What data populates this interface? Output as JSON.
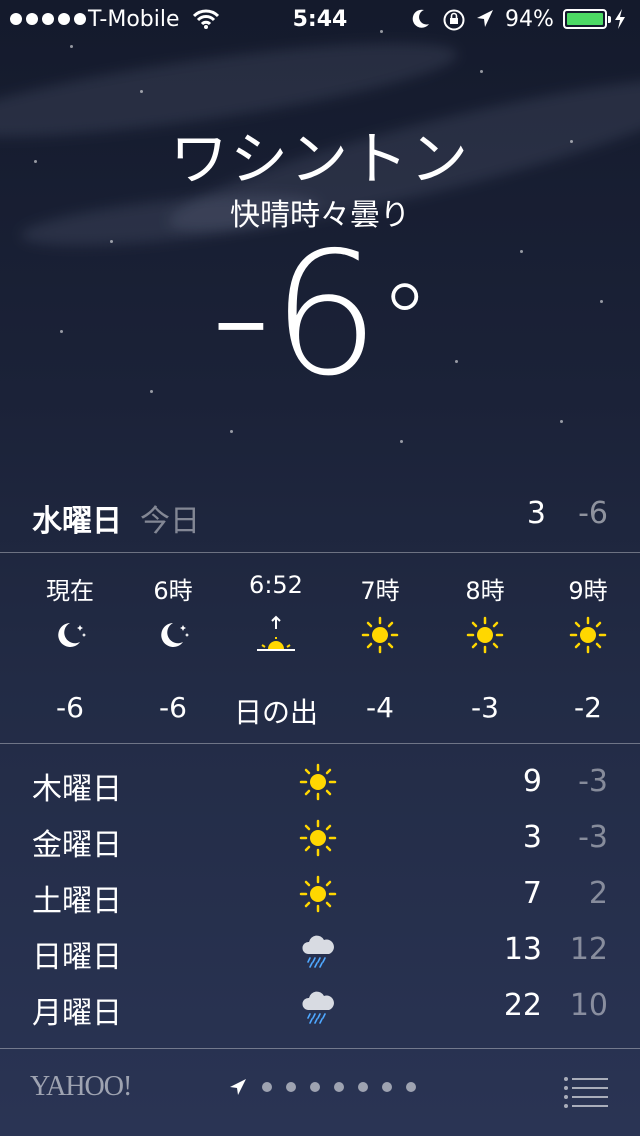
{
  "status_bar": {
    "carrier": "T-Mobile",
    "time": "5:44",
    "battery_percent": "94%",
    "battery_level": 0.94,
    "signal_dots": 5
  },
  "header": {
    "city": "ワシントン",
    "condition": "快晴時々曇り",
    "temperature": "-6",
    "degree_symbol": "°"
  },
  "today": {
    "day": "水曜日",
    "label": "今日",
    "high": "3",
    "low": "-6"
  },
  "hourly": [
    {
      "time": "現在",
      "icon": "moon-stars-icon",
      "value": "-6"
    },
    {
      "time": "6時",
      "icon": "moon-stars-icon",
      "value": "-6"
    },
    {
      "time": "6:52",
      "icon": "sunrise-icon",
      "value": "日の出"
    },
    {
      "time": "7時",
      "icon": "sun-icon",
      "value": "-4"
    },
    {
      "time": "8時",
      "icon": "sun-icon",
      "value": "-3"
    },
    {
      "time": "9時",
      "icon": "sun-icon",
      "value": "-2"
    }
  ],
  "daily": [
    {
      "day": "木曜日",
      "icon": "sun-icon",
      "high": "9",
      "low": "-3"
    },
    {
      "day": "金曜日",
      "icon": "sun-icon",
      "high": "3",
      "low": "-3"
    },
    {
      "day": "土曜日",
      "icon": "sun-icon",
      "high": "7",
      "low": "2"
    },
    {
      "day": "日曜日",
      "icon": "rain-cloud-icon",
      "high": "13",
      "low": "12"
    },
    {
      "day": "月曜日",
      "icon": "rain-cloud-icon",
      "high": "22",
      "low": "10"
    }
  ],
  "footer": {
    "brand": "YAHOO!",
    "page_dots": 7
  },
  "colors": {
    "battery_fill": "#4cd964",
    "sun": "#ffd700",
    "rain": "#4fa8ff"
  }
}
